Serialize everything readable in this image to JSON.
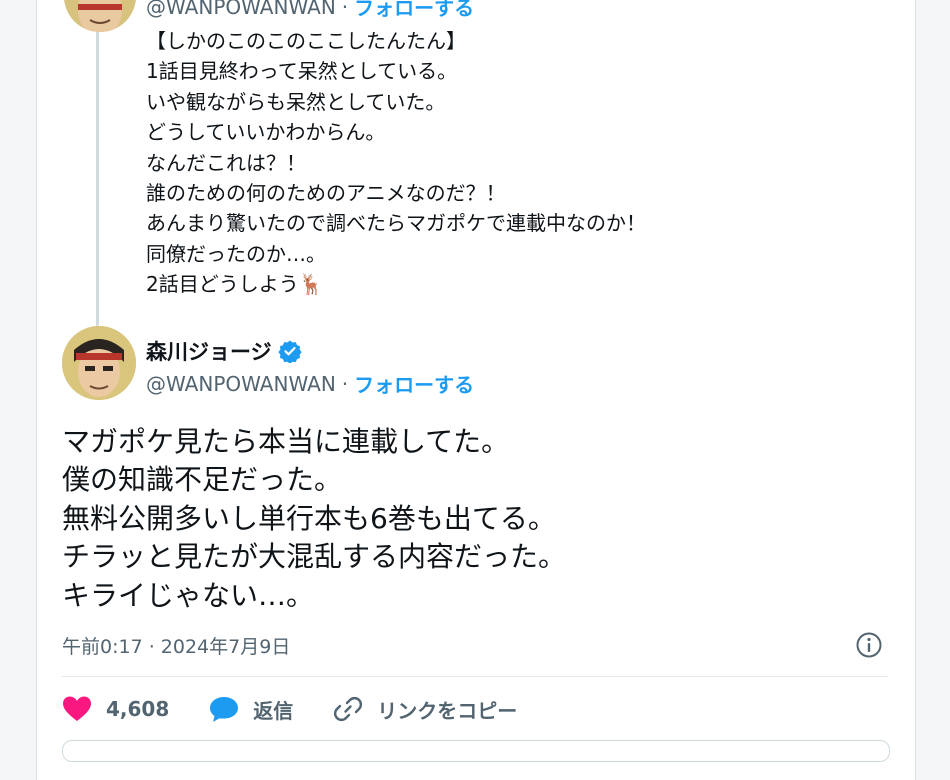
{
  "quoted_tweet": {
    "handle": "@WANPOWANWAN",
    "separator": "·",
    "follow_label": "フォローする",
    "lines": [
      "【しかのこのこのここしたんたん】",
      "1話目見終わって呆然としている。",
      "いや観ながらも呆然としていた。",
      "どうしていいかわからん。",
      "なんだこれは？！",
      "誰のための何のためのアニメなのだ？！",
      "あんまり驚いたので調べたらマガポケで連載中なのか！",
      "同僚だったのか…。",
      "2話目どうしよう🦌"
    ]
  },
  "main_tweet": {
    "display_name": "森川ジョージ",
    "handle": "@WANPOWANWAN",
    "separator": "·",
    "follow_label": "フォローする",
    "lines": [
      "マガポケ見たら本当に連載してた。",
      "僕の知識不足だった。",
      "無料公開多いし単行本も6巻も出てる。",
      "チラッと見たが大混乱する内容だった。",
      "キライじゃない…。"
    ],
    "timestamp": "午前0:17 · 2024年7月9日"
  },
  "actions": {
    "like_count": "4,608",
    "reply_label": "返信",
    "copy_link_label": "リンクをコピー"
  },
  "colors": {
    "accent": "#1d9bf0",
    "like": "#f91880",
    "text": "#0f1419",
    "muted": "#536471"
  },
  "icons": [
    "avatar",
    "verified-badge-icon",
    "info-icon",
    "heart-icon",
    "reply-bubble-icon",
    "link-icon"
  ]
}
